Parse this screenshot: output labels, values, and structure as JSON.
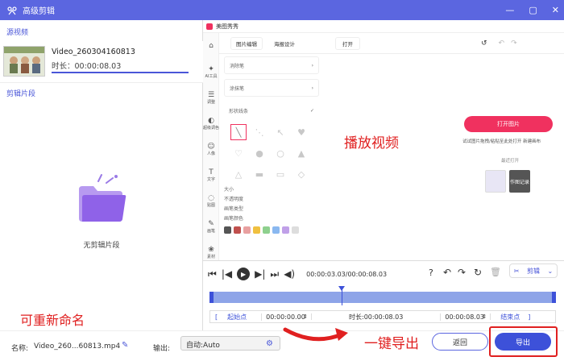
{
  "window": {
    "title": "高级剪辑",
    "controls": [
      "—",
      "▢",
      "✕"
    ]
  },
  "left": {
    "source_header": "源视频",
    "video": {
      "name": "Video_260304160813",
      "duration": "时长：00:00:08.03"
    },
    "clips_header": "剪辑片段",
    "empty_text": "无剪辑片段"
  },
  "preview": {
    "app_name": "美图秀秀",
    "tabs": [
      "图片编辑",
      "海报设计"
    ],
    "open_menu": "打开",
    "rail": [
      "AI工具",
      "调整",
      "超级调色",
      "人像",
      "文字",
      "贴图",
      "画笔",
      "素材"
    ],
    "panel_rows": [
      "消除笔",
      "涂抹笔",
      "形状线条"
    ],
    "sliders": [
      "大小",
      "不透明度",
      "画笔类型",
      "画笔颜色"
    ],
    "open_button": "打开图片",
    "open_tip": "试试图片拖拽/粘贴至此处打开 新建画布",
    "recent": "最近打开",
    "recent_thumb": "作图记录",
    "overlay_label": "播放视频"
  },
  "controls": {
    "time": "00:00:03.03/00:00:08.03",
    "edit_label": "剪辑",
    "start_label": "起始点",
    "start_time": "00:00:00.00",
    "duration": "时长:00:00:08.03",
    "end_time": "00:00:08.03",
    "end_label": "结束点"
  },
  "bottom": {
    "name_label": "名称:",
    "name_value": "Video_260...60813.mp4",
    "output_label": "输出:",
    "output_value": "自动:Auto",
    "back_label": "返回",
    "export_label": "导出"
  },
  "annotations": {
    "rename": "可重新命名",
    "export": "一键导出"
  },
  "colors": {
    "accent": "#3d51d9",
    "title_bar": "#5b66e0",
    "annotation": "#e02020",
    "open_button": "#f0315f"
  }
}
